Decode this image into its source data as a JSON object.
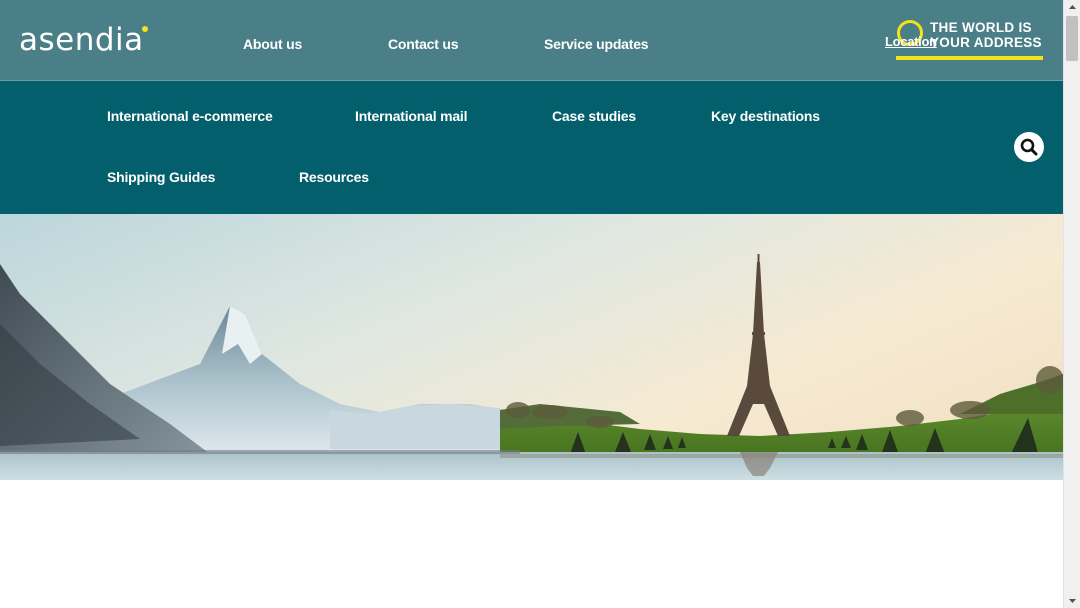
{
  "brand": {
    "logo_text": "asendia"
  },
  "top_nav": {
    "about": "About us",
    "contact": "Contact us",
    "service": "Service updates"
  },
  "header_right": {
    "location": "Location",
    "tagline_line1": "THE WORLD IS",
    "tagline_line2": "YOUR ADDRESS"
  },
  "main_nav": {
    "items": [
      {
        "label": "International e-commerce"
      },
      {
        "label": "International mail"
      },
      {
        "label": "Case studies"
      },
      {
        "label": "Key destinations"
      },
      {
        "label": "Shipping Guides"
      },
      {
        "label": "Resources"
      }
    ]
  },
  "icons": {
    "search": "search-icon",
    "scroll_up": "arrow-up-icon",
    "scroll_down": "arrow-down-icon"
  },
  "colors": {
    "topbar": "#4a7f87",
    "mainnav": "#035f6c",
    "accent_yellow": "#f4e31a"
  },
  "hero": {
    "description_alt": ""
  }
}
